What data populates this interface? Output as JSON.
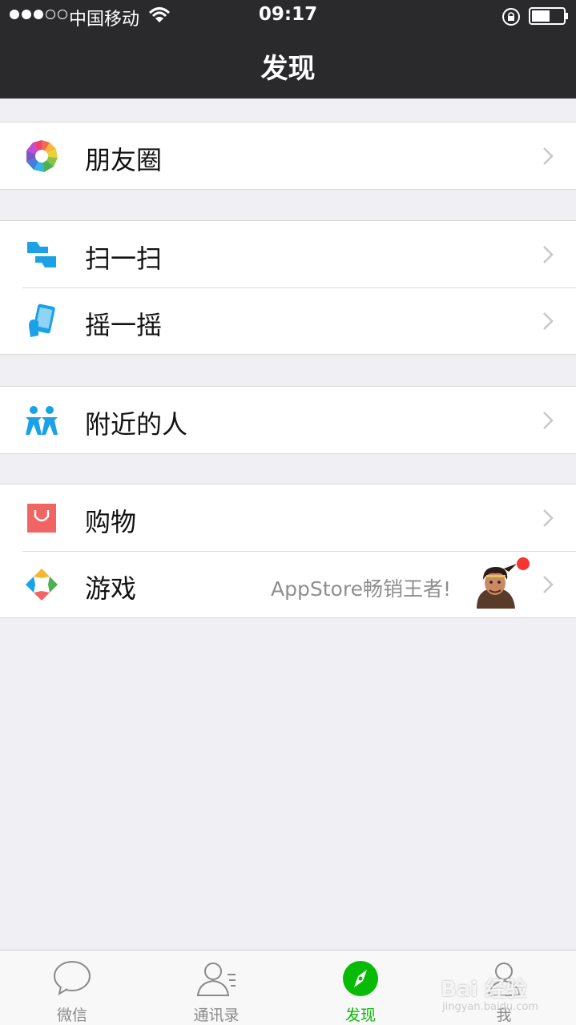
{
  "status_bar": {
    "carrier": "中国移动",
    "time": "09:17",
    "signal_bars_filled": 3,
    "signal_bars_total": 5
  },
  "nav": {
    "title": "发现"
  },
  "groups": [
    {
      "items": [
        {
          "label": "朋友圈",
          "icon": "moments-icon"
        }
      ]
    },
    {
      "items": [
        {
          "label": "扫一扫",
          "icon": "scan-icon"
        },
        {
          "label": "摇一摇",
          "icon": "shake-icon"
        }
      ]
    },
    {
      "items": [
        {
          "label": "附近的人",
          "icon": "people-nearby-icon"
        }
      ]
    },
    {
      "items": [
        {
          "label": "购物",
          "icon": "shopping-bag-icon"
        },
        {
          "label": "游戏",
          "icon": "games-icon",
          "extra": "AppStore畅销王者!",
          "has_badge": true
        }
      ]
    }
  ],
  "tabbar": {
    "tabs": [
      {
        "label": "微信",
        "icon": "chat-bubble-icon",
        "active": false
      },
      {
        "label": "通讯录",
        "icon": "contacts-icon",
        "active": false
      },
      {
        "label": "发现",
        "icon": "compass-icon",
        "active": true
      },
      {
        "label": "我",
        "icon": "me-icon",
        "active": false
      }
    ]
  },
  "watermark": {
    "text": "Bai 经验",
    "sub": "jingyan.baidu.com"
  },
  "colors": {
    "nav_bg": "#2a2a2d",
    "page_bg": "#efeff4",
    "active_tab": "#09bb07",
    "badge": "#f43530"
  }
}
